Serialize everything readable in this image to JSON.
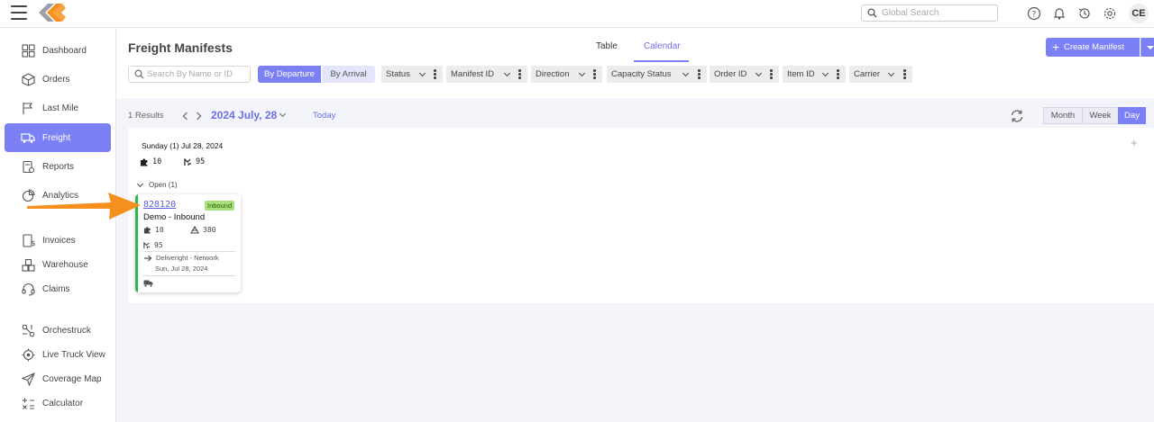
{
  "topbar": {
    "search_placeholder": "Global Search",
    "avatar_initials": "CE",
    "icons": [
      "help-icon",
      "bell-icon",
      "history-icon",
      "gear-icon"
    ]
  },
  "sidebar": {
    "items": [
      {
        "label": "Dashboard",
        "icon": "dashboard-icon"
      },
      {
        "label": "Orders",
        "icon": "box-icon"
      },
      {
        "label": "Last Mile",
        "icon": "route-icon"
      },
      {
        "label": "Freight",
        "icon": "truck-icon",
        "active": true
      },
      {
        "label": "Reports",
        "icon": "report-icon"
      },
      {
        "label": "Analytics",
        "icon": "pie-icon"
      },
      {
        "label": "Invoices",
        "icon": "invoice-icon"
      },
      {
        "label": "Warehouse",
        "icon": "warehouse-icon"
      },
      {
        "label": "Claims",
        "icon": "headset-icon"
      },
      {
        "label": "Orchestruck",
        "icon": "orchestrate-icon"
      },
      {
        "label": "Live Truck View",
        "icon": "target-icon"
      },
      {
        "label": "Coverage Map",
        "icon": "send-icon"
      },
      {
        "label": "Calculator",
        "icon": "calculator-icon"
      }
    ]
  },
  "header": {
    "title": "Freight Manifests",
    "tabs": [
      {
        "label": "Table",
        "active": false
      },
      {
        "label": "Calendar",
        "active": true
      }
    ],
    "create_label": "Create Manifest"
  },
  "filters": {
    "search_placeholder": "Search By Name or ID",
    "by_departure": "By Departure",
    "by_arrival": "By Arrival",
    "chips": [
      "Status",
      "Manifest ID",
      "Direction",
      "Capacity Status",
      "Order ID",
      "Item ID",
      "Carrier"
    ]
  },
  "calendar": {
    "results": "1 Results",
    "date": "2024 July, 28",
    "today": "Today",
    "ranges": [
      {
        "label": "Month",
        "active": false
      },
      {
        "label": "Week",
        "active": false
      },
      {
        "label": "Day",
        "active": true
      }
    ],
    "day_header": "Sunday (1) Jul 28, 2024",
    "pieces": "10",
    "weight": "95",
    "group_label": "Open (1)",
    "card": {
      "id": "828120",
      "badge": "Inbound",
      "name": "Demo - Inbound",
      "pieces": "10",
      "volume": "380",
      "weight": "95",
      "route": "Deliveright - Network",
      "date": "Sun, Jul 28, 2024"
    }
  },
  "colors": {
    "accent": "#7b80f5",
    "status_green": "#2eb84b",
    "badge_green": "#a8e07a",
    "annotation_orange": "#f5901f"
  }
}
